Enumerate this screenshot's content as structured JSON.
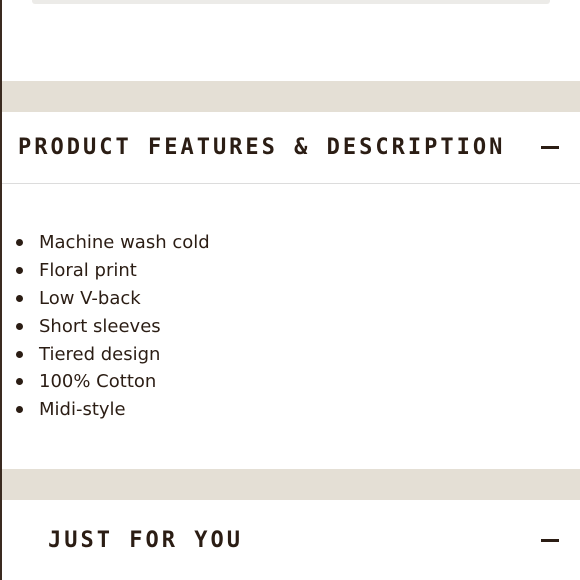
{
  "product_features": {
    "title": "PRODUCT FEATURES & DESCRIPTION",
    "toggle_icon": "minus-icon",
    "items": [
      "Machine wash cold",
      "Floral print",
      "Low V-back",
      "Short sleeves",
      "Tiered design",
      "100% Cotton",
      "Midi-style"
    ]
  },
  "just_for_you": {
    "title": "JUST FOR YOU",
    "toggle_icon": "minus-icon"
  },
  "colors": {
    "text": "#2b1d14",
    "band": "#e4dfd5",
    "divider": "#dcdcdc"
  }
}
